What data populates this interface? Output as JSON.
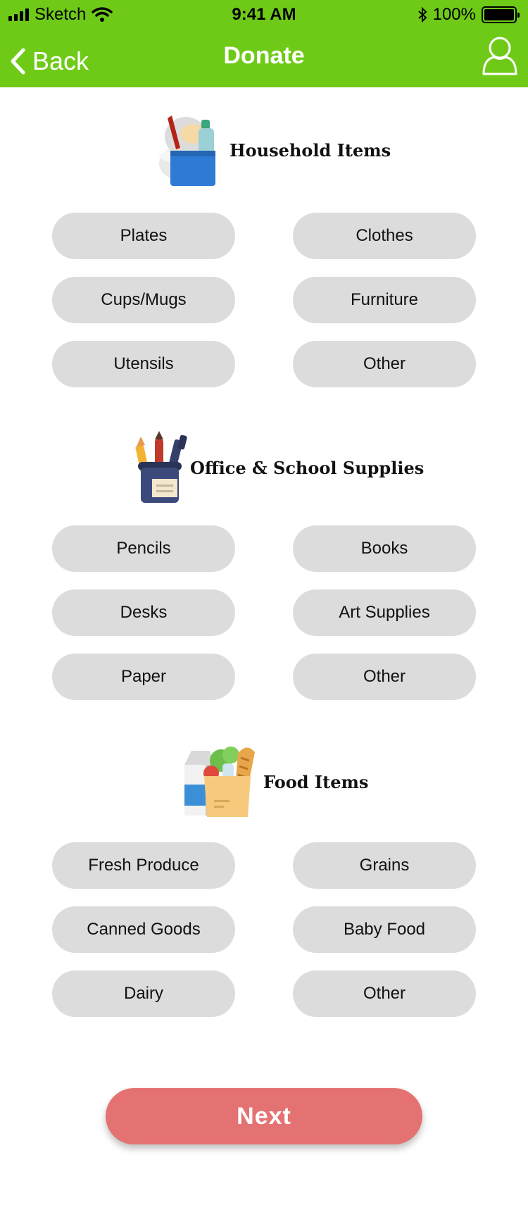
{
  "status_bar": {
    "carrier": "Sketch",
    "time": "9:41 AM",
    "battery": "100%"
  },
  "nav": {
    "back_label": "Back",
    "title": "Donate"
  },
  "sections": [
    {
      "title": "Household Items",
      "items": [
        "Plates",
        "Clothes",
        "Cups/Mugs",
        "Furniture",
        "Utensils",
        "Other"
      ]
    },
    {
      "title": "Office & School Supplies",
      "items": [
        "Pencils",
        "Books",
        "Desks",
        "Art Supplies",
        "Paper",
        "Other"
      ]
    },
    {
      "title": "Food Items",
      "items": [
        "Fresh Produce",
        "Grains",
        "Canned Goods",
        "Baby Food",
        "Dairy",
        "Other"
      ]
    }
  ],
  "next_label": "Next",
  "colors": {
    "header": "#6fca18",
    "pill": "#dcdcdc",
    "next_button": "#e57272"
  }
}
